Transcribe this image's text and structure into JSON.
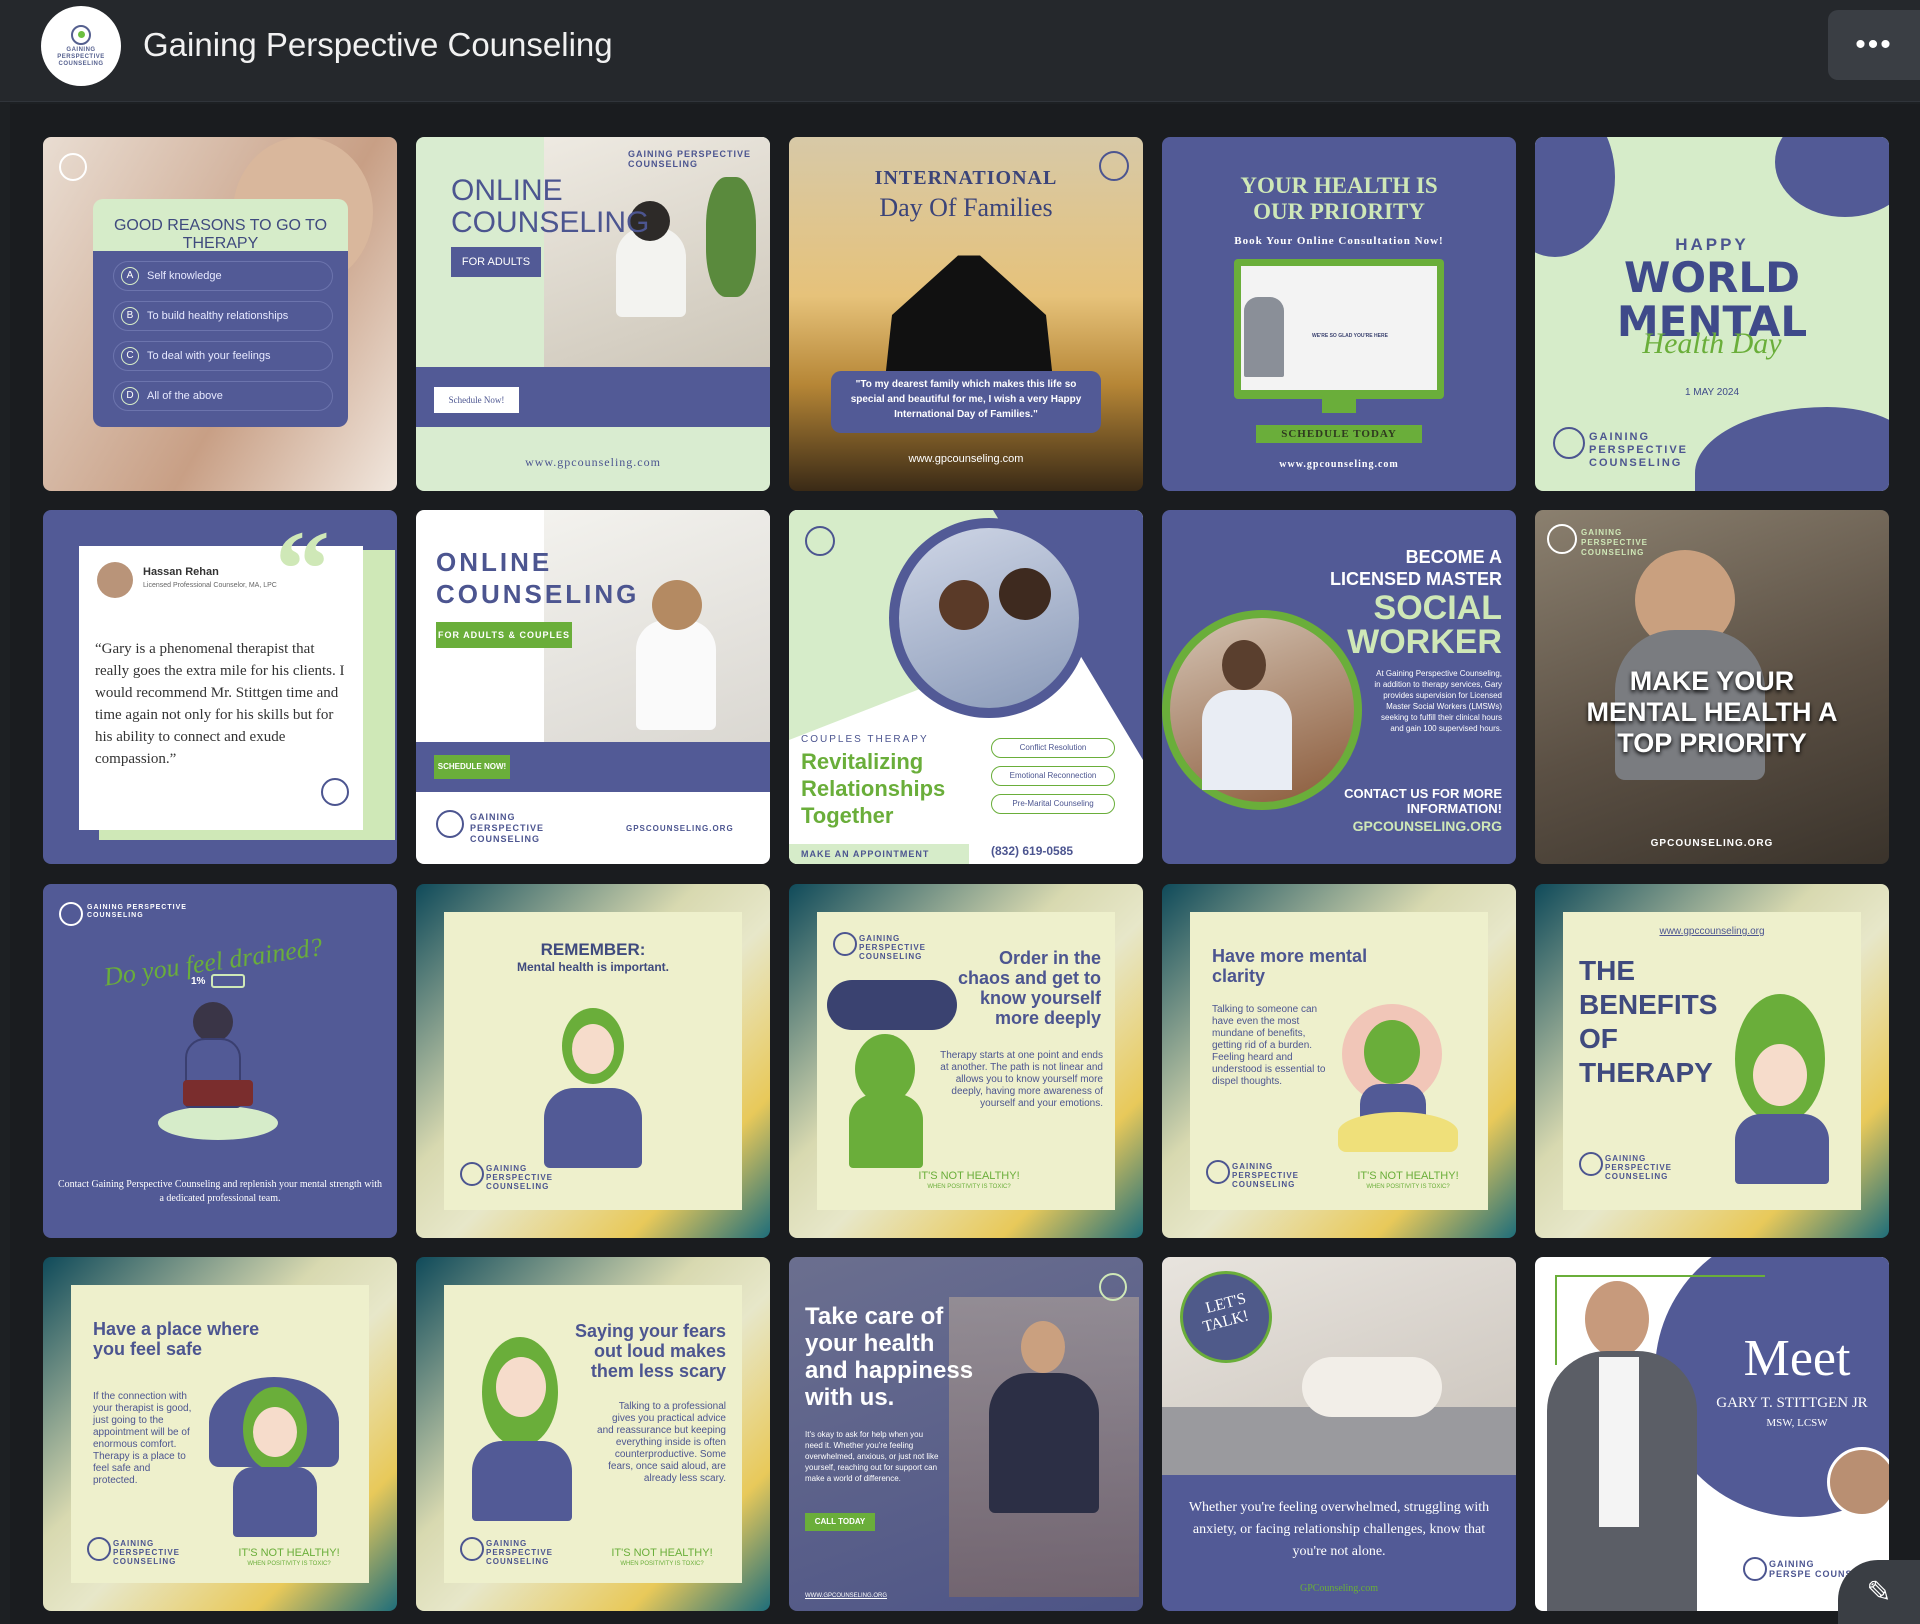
{
  "header": {
    "title": "Gaining Perspective Counseling",
    "logo_text": "GAINING PERSPECTIVE COUNSELING",
    "more_label": "•••"
  },
  "tiles": [
    {
      "title": "GOOD REASONS TO GO TO THERAPY",
      "items": [
        "Self knowledge",
        "To build healthy relationships",
        "To deal with your feelings",
        "All of the above"
      ],
      "letters": [
        "A",
        "B",
        "C",
        "D"
      ]
    },
    {
      "title1": "ONLINE",
      "title2": "COUNSELING",
      "badge": "FOR ADULTS",
      "cta": "Schedule Now!",
      "url": "www.gpcounseling.com",
      "brand": "GAINING PERSPECTIVE COUNSELING"
    },
    {
      "title1": "INTERNATIONAL",
      "title2": "Day Of Families",
      "quote": "\"To my dearest family which makes this life so special and beautiful for me, I wish a very Happy International Day of Families.\"",
      "url": "www.gpcounseling.com"
    },
    {
      "title1": "YOUR HEALTH IS",
      "title2": "OUR PRIORITY",
      "sub": "Book Your Online Consultation Now!",
      "cta": "SCHEDULE TODAY",
      "url": "www.gpcounseling.com",
      "screen_text": "WE'RE SO GLAD YOU'RE HERE"
    },
    {
      "happy": "HAPPY",
      "line1": "WORLD",
      "line2": "MENTAL",
      "script": "Health Day",
      "date": "1 MAY 2024",
      "brand": "GAINING PERSPECTIVE COUNSELING"
    },
    {
      "name": "Hassan Rehan",
      "role": "Licensed Professional Counselor, MA, LPC",
      "quote": "“Gary is a phenomenal therapist that really goes the extra mile for his clients. I would recommend Mr. Stittgen time and time again not only for his skills but for his ability to connect and exude compassion.”"
    },
    {
      "title1": "ONLINE",
      "title2": "COUNSELING",
      "badge": "FOR ADULTS & COUPLES",
      "cta": "SCHEDULE NOW!",
      "url": "GPSCOUNSELING.ORG",
      "brand": "GAINING PERSPECTIVE COUNSELING"
    },
    {
      "kicker": "COUPLES THERAPY",
      "title": [
        "Revitalizing",
        "Relationships",
        "Together"
      ],
      "services": [
        "Conflict Resolution",
        "Emotional Reconnection",
        "Pre-Marital Counseling"
      ],
      "cta": "MAKE AN APPOINTMENT",
      "phone": "(832) 619-0585"
    },
    {
      "title": [
        "BECOME A",
        "LICENSED MASTER"
      ],
      "big": [
        "SOCIAL",
        "WORKER"
      ],
      "body": "At Gaining Perspective Counseling, in addition to therapy services, Gary provides supervision for Licensed Master Social Workers (LMSWs) seeking to fulfill their clinical hours and gain 100 supervised hours.",
      "contact": "CONTACT US FOR MORE INFORMATION!",
      "url": "GPCOUNSELING.ORG"
    },
    {
      "title": [
        "MAKE YOUR",
        "MENTAL HEALTH A",
        "TOP PRIORITY"
      ],
      "url": "GPCOUNSELING.ORG",
      "brand": "GAINING PERSPECTIVE COUNSELING"
    },
    {
      "title": "Do you feel drained?",
      "battery": "1%",
      "body": "Contact Gaining Perspective Counseling and replenish your mental strength with a dedicated professional team.",
      "brand": "GAINING PERSPECTIVE COUNSELING"
    },
    {
      "title": "REMEMBER:",
      "sub": "Mental health is important.",
      "brand": "GAINING PERSPECTIVE COUNSELING"
    },
    {
      "title": [
        "Order in the",
        "chaos and get to",
        "know yourself",
        "more deeply"
      ],
      "body": "Therapy starts at one point and ends at another. The path is not linear and allows you to know yourself more deeply, having more awareness of yourself and your emotions.",
      "footer": "IT'S NOT HEALTHY!",
      "footer_sub": "WHEN POSITIVITY IS TOXIC?",
      "brand": "GAINING PERSPECTIVE COUNSELING"
    },
    {
      "title": [
        "Have more mental",
        "clarity"
      ],
      "body": "Talking to someone can have even the most mundane of benefits, getting rid of a burden. Feeling heard and understood is essential to dispel thoughts.",
      "footer": "IT'S NOT HEALTHY!",
      "footer_sub": "WHEN POSITIVITY IS TOXIC?",
      "brand": "GAINING PERSPECTIVE COUNSELING"
    },
    {
      "url": "www.gpccounseling.org",
      "title": [
        "THE",
        "BENEFITS",
        "OF",
        "THERAPY"
      ],
      "brand": "GAINING PERSPECTIVE COUNSELING"
    },
    {
      "title": [
        "Have a place where",
        "you feel safe"
      ],
      "body": "If the connection with your therapist is good, just going to the appointment will be of enormous comfort. Therapy is a place to feel safe and protected.",
      "footer": "IT'S NOT HEALTHY!",
      "footer_sub": "WHEN POSITIVITY IS TOXIC?",
      "brand": "GAINING PERSPECTIVE COUNSELING"
    },
    {
      "title": [
        "Saying your fears",
        "out loud makes",
        "them less scary"
      ],
      "body": "Talking to a professional gives you practical advice and reassurance but keeping everything inside is often counterproductive. Some fears, once said aloud, are already less scary.",
      "footer": "IT'S NOT HEALTHY!",
      "footer_sub": "WHEN POSITIVITY IS TOXIC?",
      "brand": "GAINING PERSPECTIVE COUNSELING"
    },
    {
      "title": [
        "Take care of",
        "your health",
        "and happiness",
        "with us."
      ],
      "body": "It's okay to ask for help when you need it. Whether you're feeling overwhelmed, anxious, or just not like yourself, reaching out for support can make a world of difference.",
      "cta": "CALL TODAY",
      "url": "WWW.GPCOUNSELING.ORG"
    },
    {
      "badge": [
        "LET'S",
        "TALK!"
      ],
      "body": "Whether you're feeling overwhelmed, struggling with anxiety, or facing relationship challenges, know that you're not alone.",
      "url": "GPCounseling.com"
    },
    {
      "meet": "Meet",
      "name": "GARY T. STITTGEN JR",
      "creds": "MSW, LCSW",
      "brand": "GAINING PERSPE COUNS"
    }
  ],
  "colors": {
    "navy": "#525a96",
    "green": "#6aae3a",
    "mint": "#d6ecc9",
    "background": "#1d2023"
  },
  "icons": {
    "more": "ellipsis-icon",
    "edit": "edit-icon"
  }
}
